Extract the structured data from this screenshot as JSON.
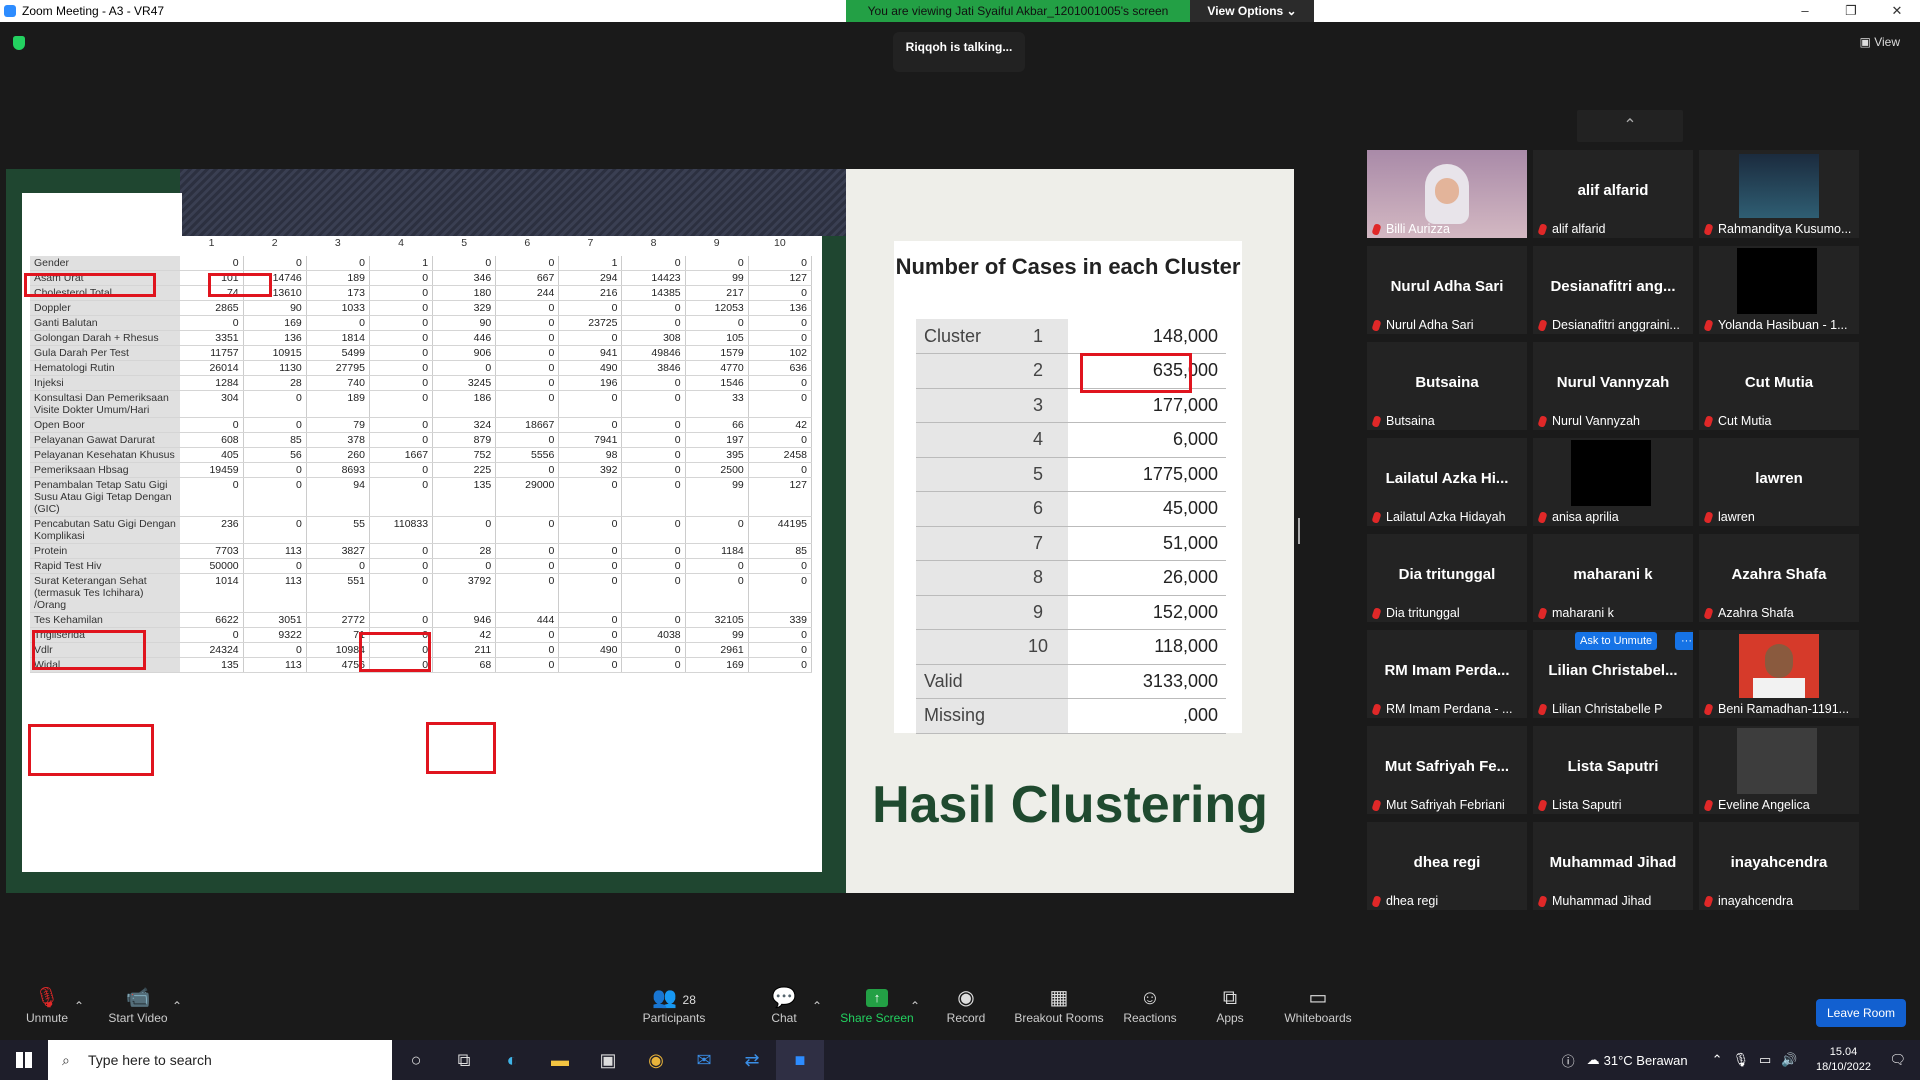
{
  "window": {
    "title": "Zoom Meeting - A3 - VR47",
    "minimize": "–",
    "maximize": "❐",
    "close": "✕"
  },
  "banner": {
    "message": "You are viewing Jati Syaiful Akbar_1201001005's screen",
    "view_options": "View Options ⌄"
  },
  "talking": "Riqqoh is talking...",
  "view_label": "▣ View",
  "shared": {
    "columns": [
      "1",
      "2",
      "3",
      "4",
      "5",
      "6",
      "7",
      "8",
      "9",
      "10"
    ],
    "rows": [
      {
        "label": "Gender",
        "values": [
          "0",
          "0",
          "0",
          "1",
          "0",
          "0",
          "1",
          "0",
          "0",
          "0"
        ]
      },
      {
        "label": "Asam Urat",
        "values": [
          "101",
          "14746",
          "189",
          "0",
          "346",
          "667",
          "294",
          "14423",
          "99",
          "127"
        ]
      },
      {
        "label": "Cholesterol Total",
        "values": [
          "74",
          "13610",
          "173",
          "0",
          "180",
          "244",
          "216",
          "14385",
          "217",
          "0"
        ]
      },
      {
        "label": "Doppler",
        "values": [
          "2865",
          "90",
          "1033",
          "0",
          "329",
          "0",
          "0",
          "0",
          "12053",
          "136"
        ]
      },
      {
        "label": "Ganti Balutan",
        "values": [
          "0",
          "169",
          "0",
          "0",
          "90",
          "0",
          "23725",
          "0",
          "0",
          "0"
        ]
      },
      {
        "label": "Golongan Darah + Rhesus",
        "values": [
          "3351",
          "136",
          "1814",
          "0",
          "446",
          "0",
          "0",
          "308",
          "105",
          "0"
        ]
      },
      {
        "label": "Gula Darah Per Test",
        "values": [
          "11757",
          "10915",
          "5499",
          "0",
          "906",
          "0",
          "941",
          "49846",
          "1579",
          "102"
        ]
      },
      {
        "label": "Hematologi Rutin",
        "values": [
          "26014",
          "1130",
          "27795",
          "0",
          "0",
          "0",
          "490",
          "3846",
          "4770",
          "636"
        ]
      },
      {
        "label": "Injeksi",
        "values": [
          "1284",
          "28",
          "740",
          "0",
          "3245",
          "0",
          "196",
          "0",
          "1546",
          "0"
        ]
      },
      {
        "label": "Konsultasi Dan Pemeriksaan Visite Dokter Umum/Hari",
        "values": [
          "304",
          "0",
          "189",
          "0",
          "186",
          "0",
          "0",
          "0",
          "33",
          "0"
        ]
      },
      {
        "label": "Open Boor",
        "values": [
          "0",
          "0",
          "79",
          "0",
          "324",
          "18667",
          "0",
          "0",
          "66",
          "42"
        ]
      },
      {
        "label": "Pelayanan Gawat Darurat",
        "values": [
          "608",
          "85",
          "378",
          "0",
          "879",
          "0",
          "7941",
          "0",
          "197",
          "0"
        ]
      },
      {
        "label": "Pelayanan Kesehatan Khusus",
        "values": [
          "405",
          "56",
          "260",
          "1667",
          "752",
          "5556",
          "98",
          "0",
          "395",
          "2458"
        ]
      },
      {
        "label": "Pemeriksaan Hbsag",
        "values": [
          "19459",
          "0",
          "8693",
          "0",
          "225",
          "0",
          "392",
          "0",
          "2500",
          "0"
        ]
      },
      {
        "label": "Penambalan Tetap Satu Gigi Susu Atau Gigi Tetap Dengan (GIC)",
        "values": [
          "0",
          "0",
          "94",
          "0",
          "135",
          "29000",
          "0",
          "0",
          "99",
          "127"
        ]
      },
      {
        "label": "Pencabutan Satu Gigi Dengan Komplikasi",
        "values": [
          "236",
          "0",
          "55",
          "110833",
          "0",
          "0",
          "0",
          "0",
          "0",
          "44195"
        ]
      },
      {
        "label": "Protein",
        "values": [
          "7703",
          "113",
          "3827",
          "0",
          "28",
          "0",
          "0",
          "0",
          "1184",
          "85"
        ]
      },
      {
        "label": "Rapid Test Hiv",
        "values": [
          "50000",
          "0",
          "0",
          "0",
          "0",
          "0",
          "0",
          "0",
          "0",
          "0"
        ]
      },
      {
        "label": "Surat Keterangan Sehat (termasuk Tes Ichihara) /Orang",
        "values": [
          "1014",
          "113",
          "551",
          "0",
          "3792",
          "0",
          "0",
          "0",
          "0",
          "0"
        ]
      },
      {
        "label": "Tes Kehamilan",
        "values": [
          "6622",
          "3051",
          "2772",
          "0",
          "946",
          "444",
          "0",
          "0",
          "32105",
          "339"
        ]
      },
      {
        "label": "Trigliserida",
        "values": [
          "0",
          "9322",
          "71",
          "0",
          "42",
          "0",
          "0",
          "4038",
          "99",
          "0"
        ]
      },
      {
        "label": "Vdlr",
        "values": [
          "24324",
          "0",
          "10984",
          "0",
          "211",
          "0",
          "490",
          "0",
          "2961",
          "0"
        ]
      },
      {
        "label": "Widal",
        "values": [
          "135",
          "113",
          "4756",
          "0",
          "68",
          "0",
          "0",
          "0",
          "169",
          "0"
        ]
      }
    ],
    "cluster_title": "Number of Cases in each Cluster",
    "cluster_label": "Cluster",
    "clusters": [
      {
        "n": "1",
        "v": "148,000"
      },
      {
        "n": "2",
        "v": "635,000"
      },
      {
        "n": "3",
        "v": "177,000"
      },
      {
        "n": "4",
        "v": "6,000"
      },
      {
        "n": "5",
        "v": "1775,000"
      },
      {
        "n": "6",
        "v": "45,000"
      },
      {
        "n": "7",
        "v": "51,000"
      },
      {
        "n": "8",
        "v": "26,000"
      },
      {
        "n": "9",
        "v": "152,000"
      },
      {
        "n": "10",
        "v": "118,000"
      }
    ],
    "valid_label": "Valid",
    "valid_value": "3133,000",
    "missing_label": "Missing",
    "missing_value": ",000",
    "heading": "Hasil Clustering"
  },
  "participants": [
    {
      "name": "",
      "label": "Billi Aurizza",
      "type": "photo-girl"
    },
    {
      "name": "alif alfarid",
      "label": "alif alfarid",
      "type": "name"
    },
    {
      "name": "",
      "label": "Rahmanditya Kusumo...",
      "type": "photo-room"
    },
    {
      "name": "Nurul Adha Sari",
      "label": "Nurul Adha Sari",
      "type": "name"
    },
    {
      "name": "Desianafitri  ang...",
      "label": "Desianafitri anggraini...",
      "type": "name"
    },
    {
      "name": "",
      "label": "Yolanda Hasibuan - 1...",
      "type": "black"
    },
    {
      "name": "Butsaina",
      "label": "Butsaina",
      "type": "name"
    },
    {
      "name": "Nurul Vannyzah",
      "label": "Nurul Vannyzah",
      "type": "name"
    },
    {
      "name": "Cut Mutia",
      "label": "Cut Mutia",
      "type": "name"
    },
    {
      "name": "Lailatul  Azka  Hi...",
      "label": "Lailatul Azka Hidayah",
      "type": "name"
    },
    {
      "name": "",
      "label": "anisa aprilia",
      "type": "black"
    },
    {
      "name": "lawren",
      "label": "lawren",
      "type": "name"
    },
    {
      "name": "Dia tritunggal",
      "label": "Dia tritunggal",
      "type": "name"
    },
    {
      "name": "maharani k",
      "label": "maharani k",
      "type": "name"
    },
    {
      "name": "Azahra Shafa",
      "label": "Azahra Shafa",
      "type": "name"
    },
    {
      "name": "RM Imam Perda...",
      "label": "RM Imam Perdana - ...",
      "type": "name"
    },
    {
      "name": "Lilian  Christabel...",
      "label": "Lilian Christabelle P",
      "type": "name-ask"
    },
    {
      "name": "",
      "label": "Beni Ramadhan-1191...",
      "type": "photo-boy"
    },
    {
      "name": "Mut Safriyah Fe...",
      "label": "Mut Safriyah Febriani",
      "type": "name"
    },
    {
      "name": "Lista Saputri",
      "label": "Lista Saputri",
      "type": "name"
    },
    {
      "name": "",
      "label": "Eveline Angelica",
      "type": "gray"
    },
    {
      "name": "dhea regi",
      "label": "dhea regi",
      "type": "name"
    },
    {
      "name": "Muhammad Jihad",
      "label": "Muhammad Jihad",
      "type": "name"
    },
    {
      "name": "inayahcendra",
      "label": "inayahcendra",
      "type": "name"
    }
  ],
  "ask_unmute": "Ask to Unmute",
  "ask_more": "···",
  "toolbar": {
    "unmute": "Unmute",
    "start_video": "Start Video",
    "participants": "Participants",
    "participants_count": "28",
    "chat": "Chat",
    "share_screen": "Share Screen",
    "record": "Record",
    "breakout": "Breakout Rooms",
    "reactions": "Reactions",
    "apps": "Apps",
    "whiteboards": "Whiteboards",
    "leave": "Leave Room"
  },
  "taskbar": {
    "search_placeholder": "Type here to search",
    "weather": "31°C  Berawan",
    "time": "15.04",
    "date": "18/10/2022"
  },
  "colors": {
    "accent_green": "#23a045",
    "brand_blue": "#2d8cff",
    "highlight_red": "#e0141e"
  }
}
